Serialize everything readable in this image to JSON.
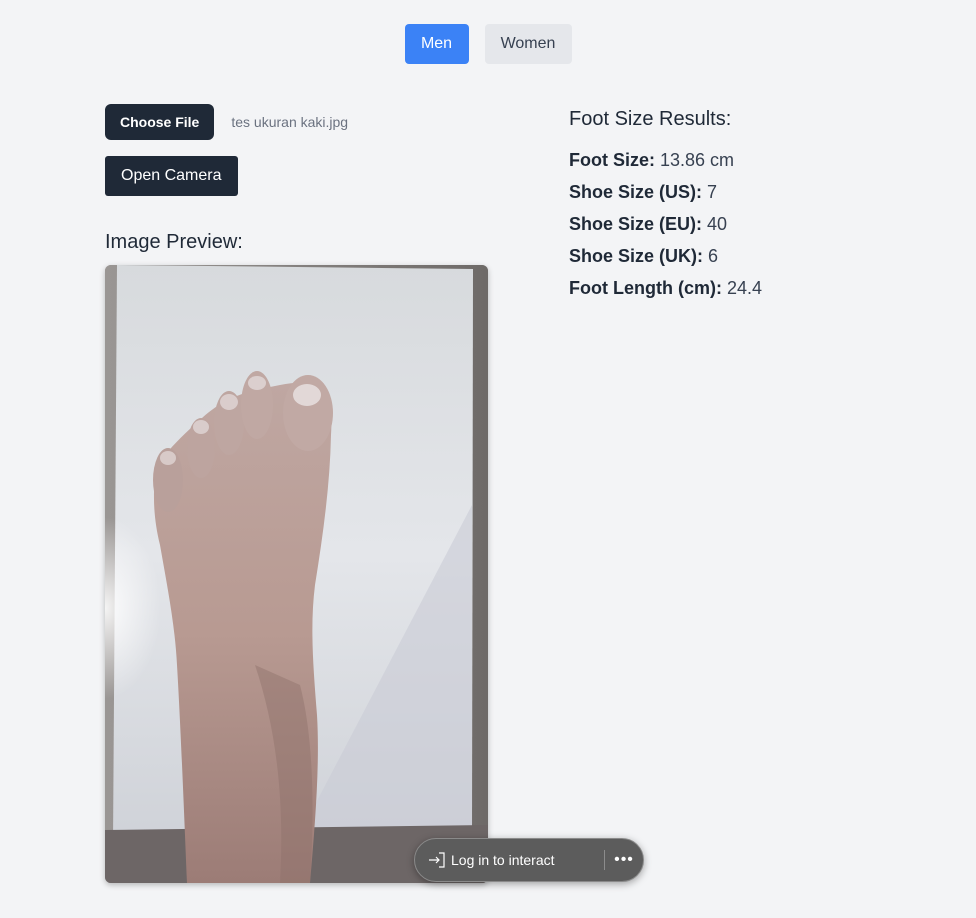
{
  "gender_toggle": {
    "men_label": "Men",
    "women_label": "Women",
    "selected": "Men",
    "active_color": "#3b82f6",
    "inactive_color": "#e5e7eb"
  },
  "upload": {
    "choose_file_label": "Choose File",
    "file_name": "tes ukuran kaki.jpg",
    "open_camera_label": "Open Camera"
  },
  "preview": {
    "heading": "Image Preview:"
  },
  "results": {
    "heading": "Foot Size Results:",
    "items": [
      {
        "label": "Foot Size:",
        "value": "13.86 cm"
      },
      {
        "label": "Shoe Size (US):",
        "value": "7"
      },
      {
        "label": "Shoe Size (EU):",
        "value": "40"
      },
      {
        "label": "Shoe Size (UK):",
        "value": "6"
      },
      {
        "label": "Foot Length (cm):",
        "value": "24.4"
      }
    ]
  },
  "overlay": {
    "login_label": "Log in to interact",
    "login_icon": "sign-in-icon",
    "more_icon": "ellipsis-icon"
  },
  "colors": {
    "page_background": "#f3f4f6",
    "dark_button": "#1f2937"
  }
}
